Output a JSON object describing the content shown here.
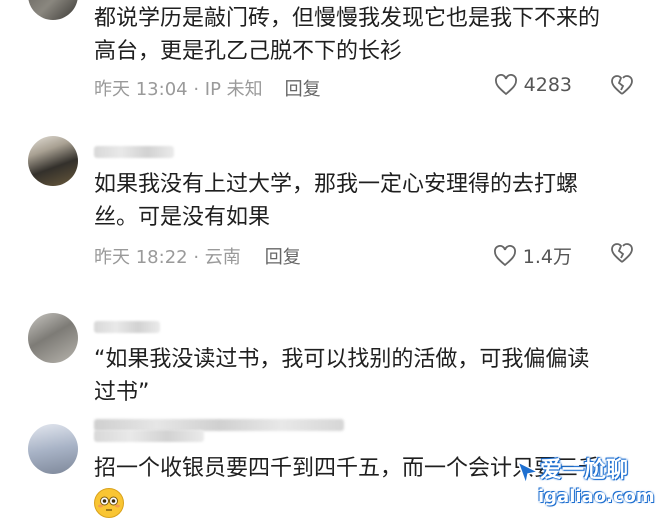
{
  "comments": [
    {
      "text_lines": [
        "都说学历是敲门砖，但慢慢我发现它也是我下不来的",
        "高台，更是孔乙己脱不下的长衫"
      ],
      "meta": "昨天 13:04 · IP 未知",
      "reply_label": "回复",
      "likes": "4283"
    },
    {
      "text_lines": [
        "如果我没有上过大学，那我一定心安理得的去打螺",
        "丝。可是没有如果"
      ],
      "meta": "昨天 18:22 · 云南",
      "reply_label": "回复",
      "likes": "1.4万"
    },
    {
      "text_lines": [
        "“如果我没读过书，我可以找别的活做，可我偏偏读",
        "过书”"
      ]
    },
    {
      "text_lines": [
        "招一个收银员要四千到四千五，而一个会计只要三千"
      ]
    }
  ],
  "watermark": {
    "title": "爱一尬聊",
    "url": "igaliao.com"
  },
  "colors": {
    "text": "#1f1f1f",
    "meta": "#9a9a9a",
    "icon": "#666666",
    "watermark_blue": "#1e6fd0"
  },
  "icons": [
    "heart-outline-icon",
    "broken-heart-icon",
    "flushed-face-emoji"
  ]
}
